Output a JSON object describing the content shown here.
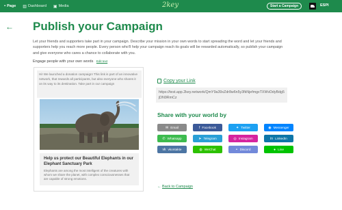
{
  "nav": {
    "items": [
      {
        "icon": "page-icon",
        "glyph": "▪",
        "label": "Page"
      },
      {
        "icon": "dashboard-icon",
        "glyph": "▥",
        "label": "Dashboard"
      },
      {
        "icon": "media-icon",
        "glyph": "▣",
        "label": "Media"
      }
    ],
    "logo": "2key",
    "start_button": "Start a Campaign",
    "user": "ESPI"
  },
  "page": {
    "back_icon": "←",
    "title": "Publish your Campaign",
    "intro": "Let your friends and supporters take part in your campaign. Describe your mission in your own words to start spreading the word and let your friends and supporters help you reach more people. Every person who'll help your campaign reach its goals will be rewarded automatically, so publish your campaign and give everyone who cares a chance to collaborate with you.",
    "engage_label": "Engage people with your own words",
    "edit_label": "Edit text"
  },
  "preview": {
    "message": "Hi! We launched a donation campaign! This link is part of an innovative network, that rewards all participants, but also everyone who shares it on its way to its destination. Take part in our campaign",
    "card_title": "Help us protect our Beautiful Elephants in our Elephant Sanctuary Park",
    "card_description": "Elephants are among the most intelligent of the creatures with whom we share the planet, with complex consciousnesses that are capable of strong emotions."
  },
  "copy": {
    "label": "Copy your Link",
    "url": "https://test.app.2key.network/QmY9a39xZdr8w6n5y3fkNjefmgxTXWvDdyBdg5jDN9RmCz"
  },
  "share": {
    "title": "Share with your world by",
    "buttons": [
      {
        "label": "Email",
        "icon": "email-icon",
        "glyph": "✉",
        "color": "#8a8a8a"
      },
      {
        "label": "Facebook",
        "icon": "facebook-icon",
        "glyph": "f",
        "color": "#3b5998"
      },
      {
        "label": "Twitter",
        "icon": "twitter-icon",
        "glyph": "✦",
        "color": "#1da1f2"
      },
      {
        "label": "Messenger",
        "icon": "messenger-icon",
        "glyph": "◉",
        "color": "#0084ff"
      },
      {
        "label": "Whatsapp",
        "icon": "whatsapp-icon",
        "glyph": "✆",
        "color": "#3dbb4e"
      },
      {
        "label": "Telegram",
        "icon": "telegram-icon",
        "glyph": "➤",
        "color": "#2a9fd6"
      },
      {
        "label": "Instagram",
        "icon": "instagram-icon",
        "glyph": "◎",
        "color": "#d6249f"
      },
      {
        "label": "LinkedIn",
        "icon": "linkedin-icon",
        "glyph": "in",
        "color": "#0e76a8"
      },
      {
        "label": "vkontakte",
        "icon": "vkontakte-icon",
        "glyph": "vk",
        "color": "#4c75a3"
      },
      {
        "label": "WeChat",
        "icon": "wechat-icon",
        "glyph": "◍",
        "color": "#2dc100"
      },
      {
        "label": "Discord",
        "icon": "discord-icon",
        "glyph": "◓",
        "color": "#7289da"
      },
      {
        "label": "Line",
        "icon": "line-icon",
        "glyph": "●",
        "color": "#00c300"
      }
    ]
  },
  "footer": {
    "back_label": "Back to Campaign",
    "back_icon": "←"
  }
}
